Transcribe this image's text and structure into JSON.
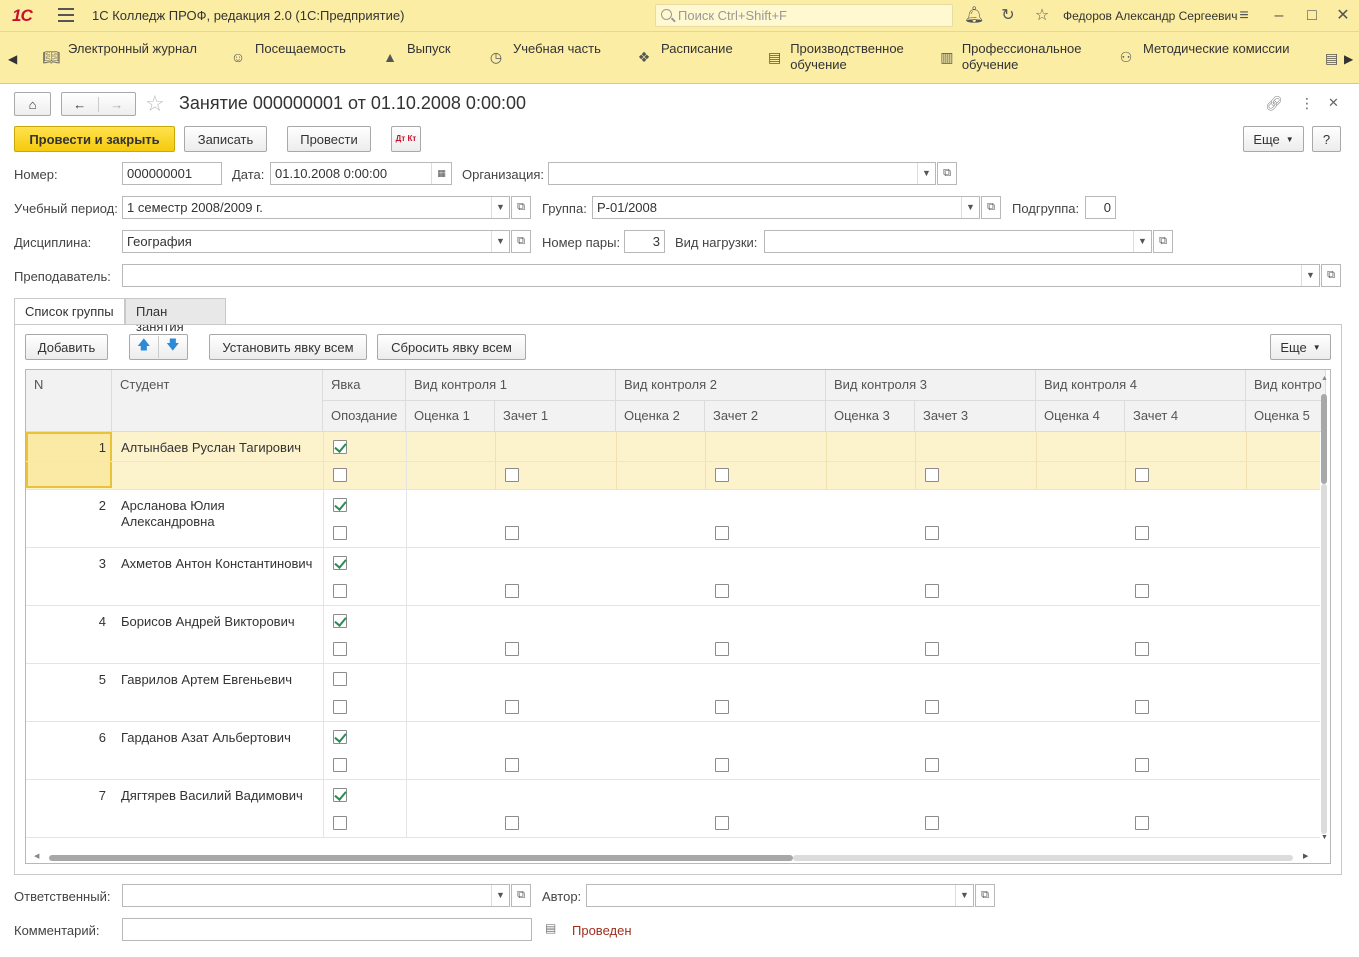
{
  "app": {
    "logo": "1С",
    "title": "1С Колледж ПРОФ, редакция 2.0  (1С:Предприятие)",
    "search_placeholder": "Поиск Ctrl+Shift+F",
    "user": "Федоров Александр Сергеевич"
  },
  "nav": [
    {
      "label": "Электронный журнал",
      "icon": "book-icon"
    },
    {
      "label": "Посещаемость",
      "icon": "person-icon"
    },
    {
      "label": "Выпуск",
      "icon": "graduation-cap-icon"
    },
    {
      "label": "Учебная часть",
      "icon": "clock-icon"
    },
    {
      "label": "Расписание",
      "icon": "schedule-icon"
    },
    {
      "label": "Производственное обучение",
      "icon": "factory-icon"
    },
    {
      "label": "Профессиональное обучение",
      "icon": "desk-icon"
    },
    {
      "label": "Методические комиссии",
      "icon": "group-icon"
    }
  ],
  "doc": {
    "title": "Занятие 000000001 от 01.10.2008 0:00:00",
    "buttons": {
      "post_close": "Провести и закрыть",
      "save": "Записать",
      "post": "Провести",
      "dtkt": "Дт Кт",
      "more": "Еще",
      "help": "?"
    }
  },
  "form": {
    "number_label": "Номер:",
    "number": "000000001",
    "date_label": "Дата:",
    "date": "01.10.2008  0:00:00",
    "org_label": "Организация:",
    "org": "",
    "period_label": "Учебный период:",
    "period": "1 семестр 2008/2009 г.",
    "group_label": "Группа:",
    "group": "Р-01/2008",
    "subgroup_label": "Подгруппа:",
    "subgroup": "0",
    "discipline_label": "Дисциплина:",
    "discipline": "География",
    "pair_label": "Номер пары:",
    "pair": "3",
    "load_label": "Вид нагрузки:",
    "load": "",
    "teacher_label": "Преподаватель:",
    "teacher": ""
  },
  "tabs": [
    "Список группы",
    "План занятия"
  ],
  "table_toolbar": {
    "add": "Добавить",
    "set_all": "Установить явку всем",
    "reset_all": "Сбросить явку всем",
    "more": "Еще"
  },
  "table": {
    "headers": {
      "n": "N",
      "student": "Студент",
      "attendance": "Явка",
      "late": "Опоздание",
      "control1": "Вид контроля 1",
      "control2": "Вид контроля 2",
      "control3": "Вид контроля 3",
      "control4": "Вид контроля 4",
      "control5": "Вид контро",
      "grade1": "Оценка 1",
      "pass1": "Зачет 1",
      "grade2": "Оценка 2",
      "pass2": "Зачет 2",
      "grade3": "Оценка 3",
      "pass3": "Зачет 3",
      "grade4": "Оценка 4",
      "pass4": "Зачет 4",
      "grade5": "Оценка 5"
    },
    "rows": [
      {
        "n": "1",
        "student": "Алтынбаев Руслан Тагирович",
        "attendance": true,
        "late": false
      },
      {
        "n": "2",
        "student": "Арсланова Юлия Александровна",
        "attendance": true,
        "late": false
      },
      {
        "n": "3",
        "student": "Ахметов Антон Константинович",
        "attendance": true,
        "late": false
      },
      {
        "n": "4",
        "student": "Борисов Андрей Викторович",
        "attendance": true,
        "late": false
      },
      {
        "n": "5",
        "student": "Гаврилов Артем Евгеньевич",
        "attendance": false,
        "late": false
      },
      {
        "n": "6",
        "student": "Гарданов Азат Альбертович",
        "attendance": true,
        "late": false
      },
      {
        "n": "7",
        "student": "Дягтярев Василий Вадимович",
        "attendance": true,
        "late": false
      }
    ]
  },
  "footer": {
    "responsible_label": "Ответственный:",
    "responsible": "",
    "author_label": "Автор:",
    "author": "",
    "comment_label": "Комментарий:",
    "comment": "",
    "status": "Проведен"
  },
  "colors": {
    "header_bg": "#fbeda4",
    "accent_button": "#f5cb0b",
    "selected_row": "#fcf3cd",
    "status": "#a0301e"
  }
}
